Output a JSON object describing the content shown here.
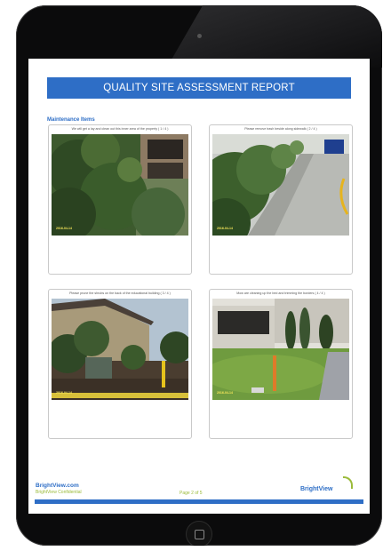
{
  "report": {
    "title": "QUALITY SITE ASSESSMENT REPORT",
    "section": "Maintenance Items",
    "cards": [
      {
        "caption": "We will get a lay and clean out this inner area of the property ( 1 / 4 )",
        "date": "2016-04-14"
      },
      {
        "caption": "Please remove trash beside along sidewalk ( 2 / 4 )",
        "date": "2016-04-14"
      },
      {
        "caption": "Please prune the shrubs on the back of the educational building ( 3 / 4 )",
        "date": "2016-04-14"
      },
      {
        "caption": "Mow are cleaning up the bed and trimming the borders ( 4 / 4 )",
        "date": "2016-04-14"
      }
    ]
  },
  "footer": {
    "url": "BrightView.com",
    "confidential": "BrightView Confidential",
    "page": "Page 2 of 5",
    "logo": "BrightView"
  },
  "colors": {
    "accent": "#2e6ec6",
    "brand_green": "#9bbb3a",
    "bezel": "#0b0b0c"
  },
  "icons": {
    "home_button": "home-button-icon",
    "camera": "front-camera-icon"
  }
}
